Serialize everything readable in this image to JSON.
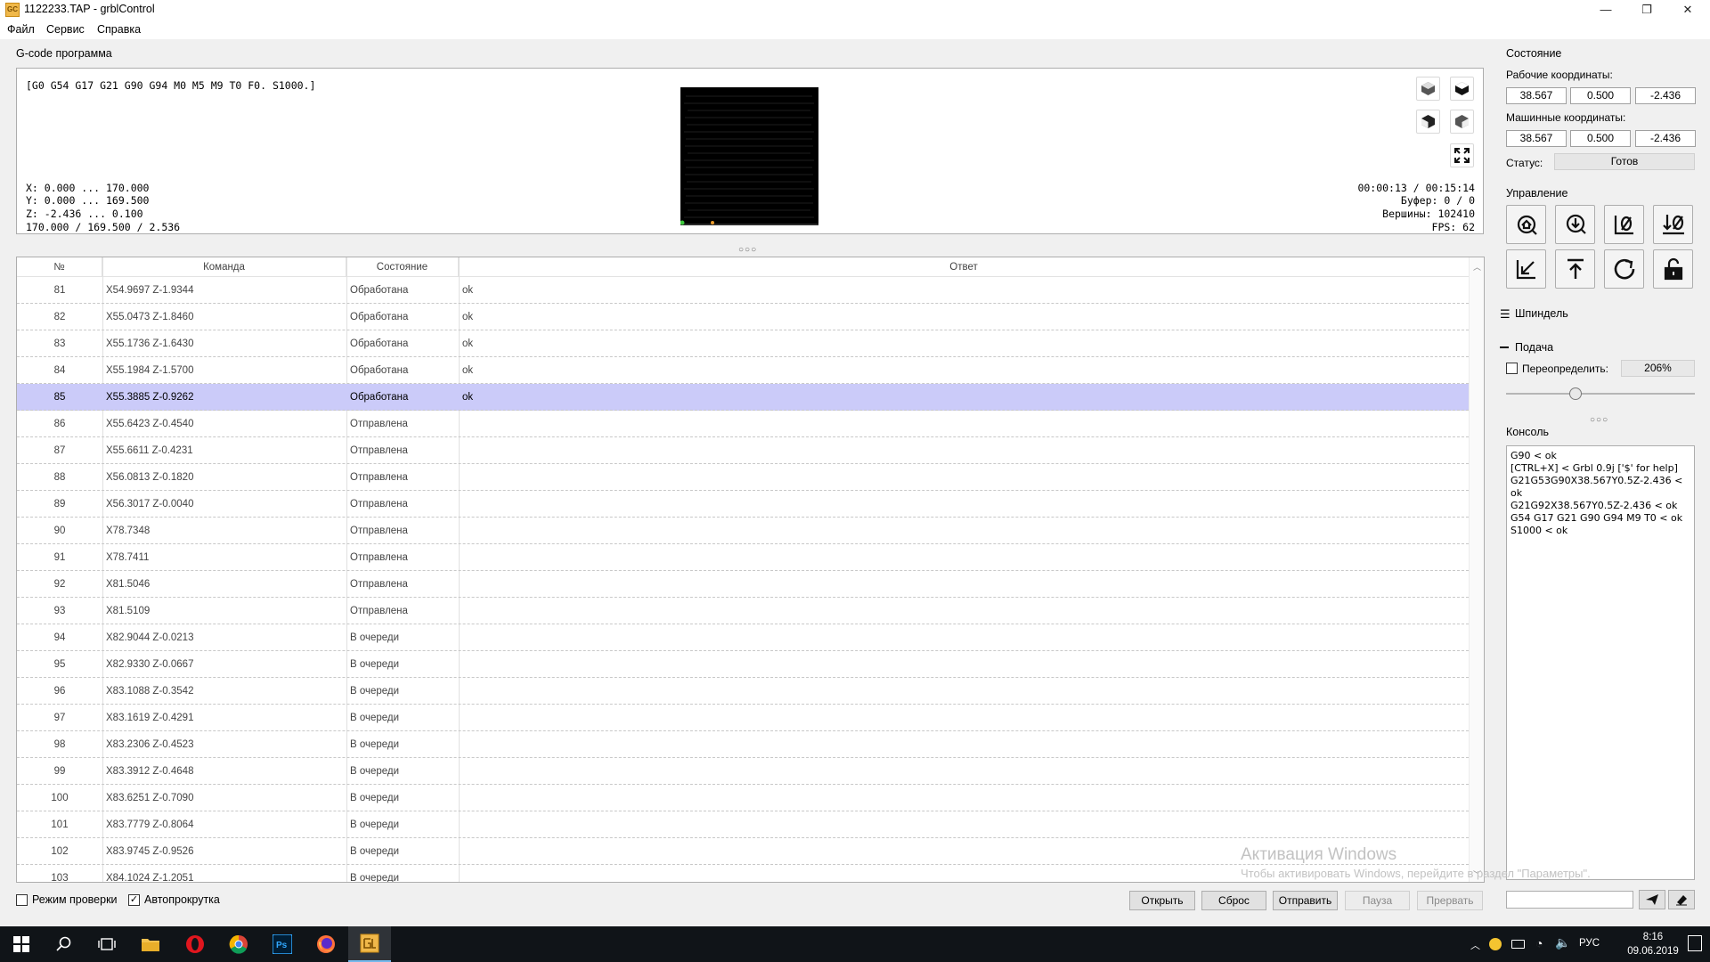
{
  "window": {
    "title": "1122233.TAP - grblControl",
    "icon_text": "GC",
    "controls": {
      "minimize": "—",
      "maximize": "❐",
      "close": "✕"
    }
  },
  "menu": [
    "Файл",
    "Сервис",
    "Справка"
  ],
  "gcode_panel": {
    "title": "G-code программа",
    "state_line": "[G0 G54 G17 G21 G90 G94 M0 M5 M9 T0 F0. S1000.]",
    "ranges": {
      "x": "X: 0.000 ... 170.000",
      "y": "Y: 0.000 ... 169.500",
      "z": "Z: -2.436 ... 0.100",
      "size": "170.000 / 169.500 / 2.536"
    },
    "stats": {
      "time": "00:00:13 / 00:15:14",
      "buffer": "Буфер: 0 / 0",
      "vertices": "Вершины: 102410",
      "fps": "FPS: 62"
    }
  },
  "table": {
    "headers": [
      "№",
      "Команда",
      "Состояние",
      "Ответ"
    ],
    "selected_index": 4,
    "rows": [
      {
        "num": "81",
        "cmd": "X54.9697  Z-1.9344",
        "state": "Обработана",
        "answer": "ok"
      },
      {
        "num": "82",
        "cmd": "X55.0473  Z-1.8460",
        "state": "Обработана",
        "answer": "ok"
      },
      {
        "num": "83",
        "cmd": "X55.1736  Z-1.6430",
        "state": "Обработана",
        "answer": "ok"
      },
      {
        "num": "84",
        "cmd": "X55.1984  Z-1.5700",
        "state": "Обработана",
        "answer": "ok"
      },
      {
        "num": "85",
        "cmd": "X55.3885  Z-0.9262",
        "state": "Обработана",
        "answer": "ok"
      },
      {
        "num": "86",
        "cmd": "X55.6423  Z-0.4540",
        "state": "Отправлена",
        "answer": ""
      },
      {
        "num": "87",
        "cmd": "X55.6611  Z-0.4231",
        "state": "Отправлена",
        "answer": ""
      },
      {
        "num": "88",
        "cmd": "X56.0813  Z-0.1820",
        "state": "Отправлена",
        "answer": ""
      },
      {
        "num": "89",
        "cmd": "X56.3017  Z-0.0040",
        "state": "Отправлена",
        "answer": ""
      },
      {
        "num": "90",
        "cmd": "X78.7348",
        "state": "Отправлена",
        "answer": ""
      },
      {
        "num": "91",
        "cmd": "X78.7411",
        "state": "Отправлена",
        "answer": ""
      },
      {
        "num": "92",
        "cmd": "X81.5046",
        "state": "Отправлена",
        "answer": ""
      },
      {
        "num": "93",
        "cmd": "X81.5109",
        "state": "Отправлена",
        "answer": ""
      },
      {
        "num": "94",
        "cmd": "X82.9044  Z-0.0213",
        "state": "В очереди",
        "answer": ""
      },
      {
        "num": "95",
        "cmd": "X82.9330  Z-0.0667",
        "state": "В очереди",
        "answer": ""
      },
      {
        "num": "96",
        "cmd": "X83.1088  Z-0.3542",
        "state": "В очереди",
        "answer": ""
      },
      {
        "num": "97",
        "cmd": "X83.1619  Z-0.4291",
        "state": "В очереди",
        "answer": ""
      },
      {
        "num": "98",
        "cmd": "X83.2306  Z-0.4523",
        "state": "В очереди",
        "answer": ""
      },
      {
        "num": "99",
        "cmd": "X83.3912  Z-0.4648",
        "state": "В очереди",
        "answer": ""
      },
      {
        "num": "100",
        "cmd": "X83.6251  Z-0.7090",
        "state": "В очереди",
        "answer": ""
      },
      {
        "num": "101",
        "cmd": "X83.7779  Z-0.8064",
        "state": "В очереди",
        "answer": ""
      },
      {
        "num": "102",
        "cmd": "X83.9745  Z-0.9526",
        "state": "В очереди",
        "answer": ""
      },
      {
        "num": "103",
        "cmd": "X84.1024  Z-1.2051",
        "state": "В очереди",
        "answer": ""
      }
    ]
  },
  "bottom": {
    "check_mode": {
      "label": "Режим проверки",
      "checked": false
    },
    "autoscroll": {
      "label": "Автопрокрутка",
      "checked": true
    },
    "buttons": {
      "open": "Открыть",
      "reset": "Сброс",
      "send": "Отправить",
      "pause": "Пауза",
      "abort": "Прервать"
    }
  },
  "state_panel": {
    "title": "Состояние",
    "work_label": "Рабочие координаты:",
    "work": [
      "38.567",
      "0.500",
      "-2.436"
    ],
    "machine_label": "Машинные координаты:",
    "machine": [
      "38.567",
      "0.500",
      "-2.436"
    ],
    "status_label": "Статус:",
    "status_value": "Готов"
  },
  "control_panel": {
    "title": "Управление",
    "buttons": [
      "home-icon",
      "zero-probe-icon",
      "zero-xy-icon",
      "zero-z-icon",
      "restore-origin-icon",
      "safe-position-icon",
      "reset-icon",
      "unlock-icon"
    ]
  },
  "spindle": {
    "title": "Шпиндель"
  },
  "feed": {
    "title": "Подача",
    "override_label": "Переопределить:",
    "override_checked": false,
    "override_value": "206%",
    "slider_fraction": 0.36
  },
  "console": {
    "title": "Консоль",
    "text": "G90 < ok\n[CTRL+X] < Grbl 0.9j ['$' for help]\nG21G53G90X38.567Y0.5Z-2.436 <\nok\nG21G92X38.567Y0.5Z-2.436 < ok\nG54 G17 G21 G90 G94 M9 T0 < ok\nS1000 < ok",
    "input_value": ""
  },
  "watermark": {
    "title": "Активация Windows",
    "subtitle": "Чтобы активировать Windows, перейдите в раздел \"Параметры\"."
  },
  "taskbar": {
    "apps": [
      "windows-start-icon",
      "search-icon",
      "task-view-icon",
      "file-explorer-icon",
      "opera-icon",
      "chrome-icon",
      "photoshop-icon",
      "firefox-icon",
      "grblcontrol-icon"
    ],
    "lang": "РУС",
    "time": "8:16",
    "date": "09.06.2019"
  }
}
